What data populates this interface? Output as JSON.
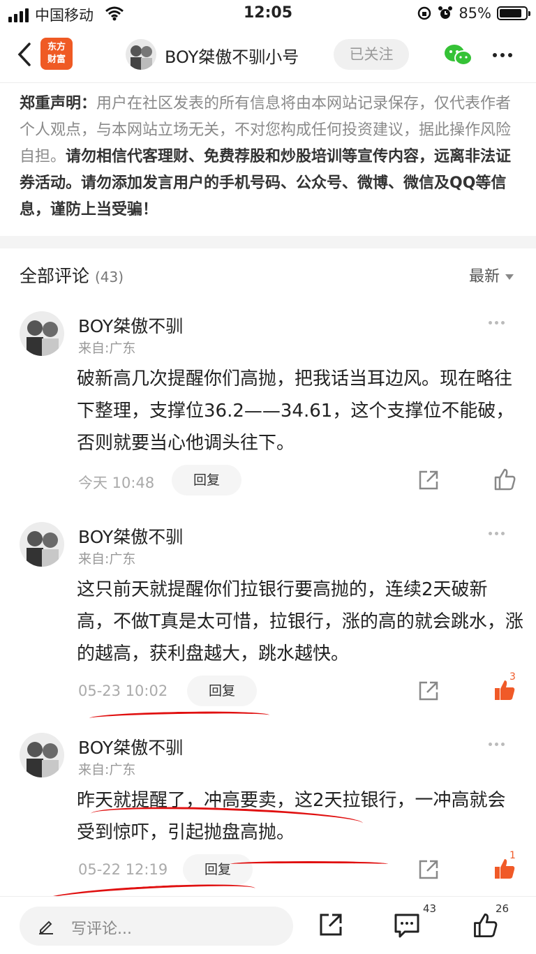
{
  "status": {
    "carrier": "中国移动",
    "time": "12:05",
    "battery": "85%",
    "battery_level": 0.85
  },
  "nav": {
    "logo_line1": "东方",
    "logo_line2": "财富",
    "title": "BOY桀傲不驯小号",
    "follow_label": "已关注"
  },
  "disclaimer": {
    "head": "郑重声明：",
    "normal": "用户在社区发表的所有信息将由本网站记录保存，仅代表作者个人观点，与本网站立场无关，不对您构成任何投资建议，据此操作风险自担。",
    "strong": "请勿相信代客理财、免费荐股和炒股培训等宣传内容，远离非法证券活动。请勿添加发言用户的手机号码、公众号、微博、微信及QQ等信息，谨防上当受骗！"
  },
  "comments_header": {
    "title": "全部评论",
    "count": "(43)",
    "sort": "最新"
  },
  "comments": [
    {
      "name": "BOY桀傲不驯",
      "location": "来自:广东",
      "text": "破新高几次提醒你们高抛，把我话当耳边风。现在略往下整理，支撑位36.2——34.61，这个支撑位不能破，否则就要当心他调头往下。",
      "time": "今天 10:48",
      "reply": "回复",
      "likes": ""
    },
    {
      "name": "BOY桀傲不驯",
      "location": "来自:广东",
      "text": "这只前天就提醒你们拉银行要高抛的，连续2天破新高，不做T真是太可惜，拉银行，涨的高的就会跳水，涨的越高，获利盘越大，跳水越快。",
      "time": "05-23 10:02",
      "reply": "回复",
      "likes": "3"
    },
    {
      "name": "BOY桀傲不驯",
      "location": "来自:广东",
      "text": "昨天就提醒了，冲高要卖，这2天拉银行，一冲高就会受到惊吓，引起抛盘高抛。",
      "time": "05-22 12:19",
      "reply": "回复",
      "likes": "1"
    }
  ],
  "bottom": {
    "placeholder": "写评论...",
    "comment_count": "43",
    "like_count": "26"
  },
  "colors": {
    "brand": "#ef5a24",
    "liked": "#f05a28",
    "annotation": "#e01010"
  }
}
